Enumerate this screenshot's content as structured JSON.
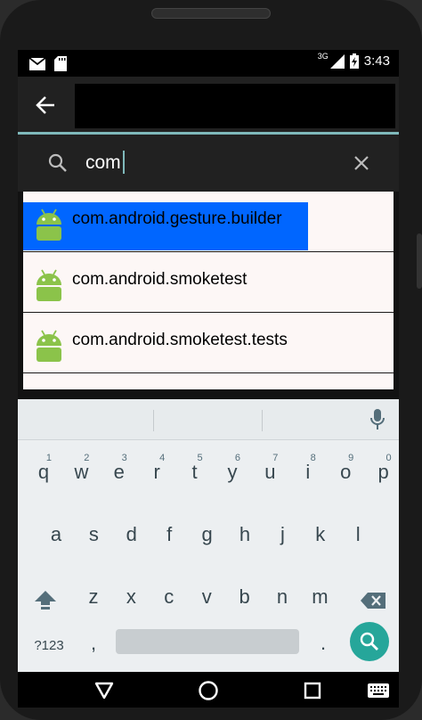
{
  "status_bar": {
    "network": "3G",
    "time": "3:43"
  },
  "search": {
    "query": "com",
    "placeholder": ""
  },
  "suggestions": [
    {
      "label": "com.android.gesture.builder",
      "selected": true
    },
    {
      "label": "com.android.smoketest",
      "selected": false
    },
    {
      "label": "com.android.smoketest.tests",
      "selected": false
    }
  ],
  "keyboard": {
    "row1": [
      {
        "key": "q",
        "hint": "1"
      },
      {
        "key": "w",
        "hint": "2"
      },
      {
        "key": "e",
        "hint": "3"
      },
      {
        "key": "r",
        "hint": "4"
      },
      {
        "key": "t",
        "hint": "5"
      },
      {
        "key": "y",
        "hint": "6"
      },
      {
        "key": "u",
        "hint": "7"
      },
      {
        "key": "i",
        "hint": "8"
      },
      {
        "key": "o",
        "hint": "9"
      },
      {
        "key": "p",
        "hint": "0"
      }
    ],
    "row2": [
      "a",
      "s",
      "d",
      "f",
      "g",
      "h",
      "j",
      "k",
      "l"
    ],
    "row3": [
      "z",
      "x",
      "c",
      "v",
      "b",
      "n",
      "m"
    ],
    "symbols_label": "?123",
    "comma": ",",
    "period": "."
  },
  "colors": {
    "accent": "#7fb9bb",
    "selection": "#0066ff",
    "android_green": "#8bc34a",
    "search_key": "#26a69a"
  }
}
